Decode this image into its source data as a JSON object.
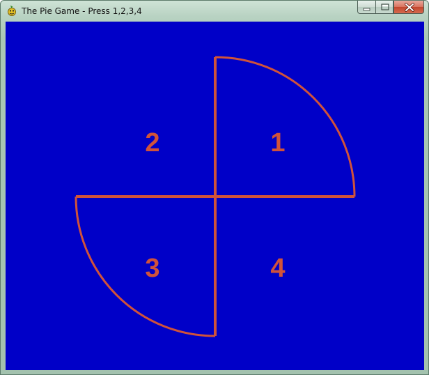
{
  "window": {
    "title": "The Pie Game - Press 1,2,3,4",
    "icon": "pygame-snake-icon",
    "buttons": [
      "minimize",
      "maximize",
      "close"
    ]
  },
  "game": {
    "background_color": "#0000c8",
    "line_color": "#d0533a",
    "quadrants": [
      {
        "label": "1",
        "filled": true
      },
      {
        "label": "2",
        "filled": false
      },
      {
        "label": "3",
        "filled": true
      },
      {
        "label": "4",
        "filled": false
      }
    ]
  }
}
